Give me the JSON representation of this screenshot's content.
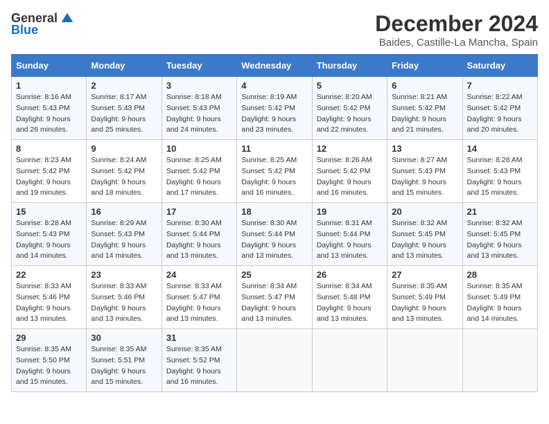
{
  "header": {
    "logo_general": "General",
    "logo_blue": "Blue",
    "title": "December 2024",
    "subtitle": "Baides, Castille-La Mancha, Spain"
  },
  "days_of_week": [
    "Sunday",
    "Monday",
    "Tuesday",
    "Wednesday",
    "Thursday",
    "Friday",
    "Saturday"
  ],
  "weeks": [
    [
      {
        "day": "1",
        "sunrise": "8:16 AM",
        "sunset": "5:43 PM",
        "daylight": "9 hours and 26 minutes."
      },
      {
        "day": "2",
        "sunrise": "8:17 AM",
        "sunset": "5:43 PM",
        "daylight": "9 hours and 25 minutes."
      },
      {
        "day": "3",
        "sunrise": "8:18 AM",
        "sunset": "5:43 PM",
        "daylight": "9 hours and 24 minutes."
      },
      {
        "day": "4",
        "sunrise": "8:19 AM",
        "sunset": "5:42 PM",
        "daylight": "9 hours and 23 minutes."
      },
      {
        "day": "5",
        "sunrise": "8:20 AM",
        "sunset": "5:42 PM",
        "daylight": "9 hours and 22 minutes."
      },
      {
        "day": "6",
        "sunrise": "8:21 AM",
        "sunset": "5:42 PM",
        "daylight": "9 hours and 21 minutes."
      },
      {
        "day": "7",
        "sunrise": "8:22 AM",
        "sunset": "5:42 PM",
        "daylight": "9 hours and 20 minutes."
      }
    ],
    [
      {
        "day": "8",
        "sunrise": "8:23 AM",
        "sunset": "5:42 PM",
        "daylight": "9 hours and 19 minutes."
      },
      {
        "day": "9",
        "sunrise": "8:24 AM",
        "sunset": "5:42 PM",
        "daylight": "9 hours and 18 minutes."
      },
      {
        "day": "10",
        "sunrise": "8:25 AM",
        "sunset": "5:42 PM",
        "daylight": "9 hours and 17 minutes."
      },
      {
        "day": "11",
        "sunrise": "8:25 AM",
        "sunset": "5:42 PM",
        "daylight": "9 hours and 16 minutes."
      },
      {
        "day": "12",
        "sunrise": "8:26 AM",
        "sunset": "5:42 PM",
        "daylight": "9 hours and 16 minutes."
      },
      {
        "day": "13",
        "sunrise": "8:27 AM",
        "sunset": "5:43 PM",
        "daylight": "9 hours and 15 minutes."
      },
      {
        "day": "14",
        "sunrise": "8:28 AM",
        "sunset": "5:43 PM",
        "daylight": "9 hours and 15 minutes."
      }
    ],
    [
      {
        "day": "15",
        "sunrise": "8:28 AM",
        "sunset": "5:43 PM",
        "daylight": "9 hours and 14 minutes."
      },
      {
        "day": "16",
        "sunrise": "8:29 AM",
        "sunset": "5:43 PM",
        "daylight": "9 hours and 14 minutes."
      },
      {
        "day": "17",
        "sunrise": "8:30 AM",
        "sunset": "5:44 PM",
        "daylight": "9 hours and 13 minutes."
      },
      {
        "day": "18",
        "sunrise": "8:30 AM",
        "sunset": "5:44 PM",
        "daylight": "9 hours and 13 minutes."
      },
      {
        "day": "19",
        "sunrise": "8:31 AM",
        "sunset": "5:44 PM",
        "daylight": "9 hours and 13 minutes."
      },
      {
        "day": "20",
        "sunrise": "8:32 AM",
        "sunset": "5:45 PM",
        "daylight": "9 hours and 13 minutes."
      },
      {
        "day": "21",
        "sunrise": "8:32 AM",
        "sunset": "5:45 PM",
        "daylight": "9 hours and 13 minutes."
      }
    ],
    [
      {
        "day": "22",
        "sunrise": "8:33 AM",
        "sunset": "5:46 PM",
        "daylight": "9 hours and 13 minutes."
      },
      {
        "day": "23",
        "sunrise": "8:33 AM",
        "sunset": "5:46 PM",
        "daylight": "9 hours and 13 minutes."
      },
      {
        "day": "24",
        "sunrise": "8:33 AM",
        "sunset": "5:47 PM",
        "daylight": "9 hours and 13 minutes."
      },
      {
        "day": "25",
        "sunrise": "8:34 AM",
        "sunset": "5:47 PM",
        "daylight": "9 hours and 13 minutes."
      },
      {
        "day": "26",
        "sunrise": "8:34 AM",
        "sunset": "5:48 PM",
        "daylight": "9 hours and 13 minutes."
      },
      {
        "day": "27",
        "sunrise": "8:35 AM",
        "sunset": "5:49 PM",
        "daylight": "9 hours and 13 minutes."
      },
      {
        "day": "28",
        "sunrise": "8:35 AM",
        "sunset": "5:49 PM",
        "daylight": "9 hours and 14 minutes."
      }
    ],
    [
      {
        "day": "29",
        "sunrise": "8:35 AM",
        "sunset": "5:50 PM",
        "daylight": "9 hours and 15 minutes."
      },
      {
        "day": "30",
        "sunrise": "8:35 AM",
        "sunset": "5:51 PM",
        "daylight": "9 hours and 15 minutes."
      },
      {
        "day": "31",
        "sunrise": "8:35 AM",
        "sunset": "5:52 PM",
        "daylight": "9 hours and 16 minutes."
      },
      null,
      null,
      null,
      null
    ]
  ],
  "labels": {
    "sunrise": "Sunrise:",
    "sunset": "Sunset:",
    "daylight": "Daylight:"
  }
}
